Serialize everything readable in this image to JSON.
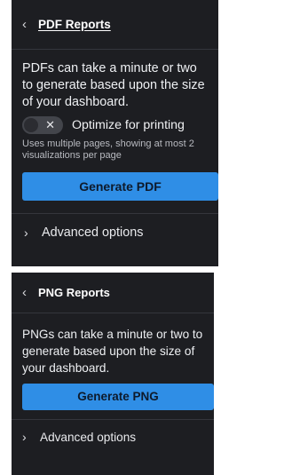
{
  "pdf": {
    "title": "PDF Reports",
    "back_glyph": "‹",
    "description": "PDFs can take a minute or two to generate based upon the size of your dashboard.",
    "toggle_label": "Optimize for printing",
    "toggle_state": "off",
    "helper_text": "Uses multiple pages, showing at most 2 visualizations per page",
    "button_label": "Generate PDF",
    "advanced_label": "Advanced options"
  },
  "png": {
    "title": "PNG Reports",
    "back_glyph": "‹",
    "description": "PNGs can take a minute or two to generate based upon the size of your dashboard.",
    "button_label": "Generate PNG",
    "advanced_label": "Advanced options"
  },
  "colors": {
    "panel_bg": "#1d1e22",
    "accent": "#2f8ee6",
    "text": "#e8e9ec"
  }
}
